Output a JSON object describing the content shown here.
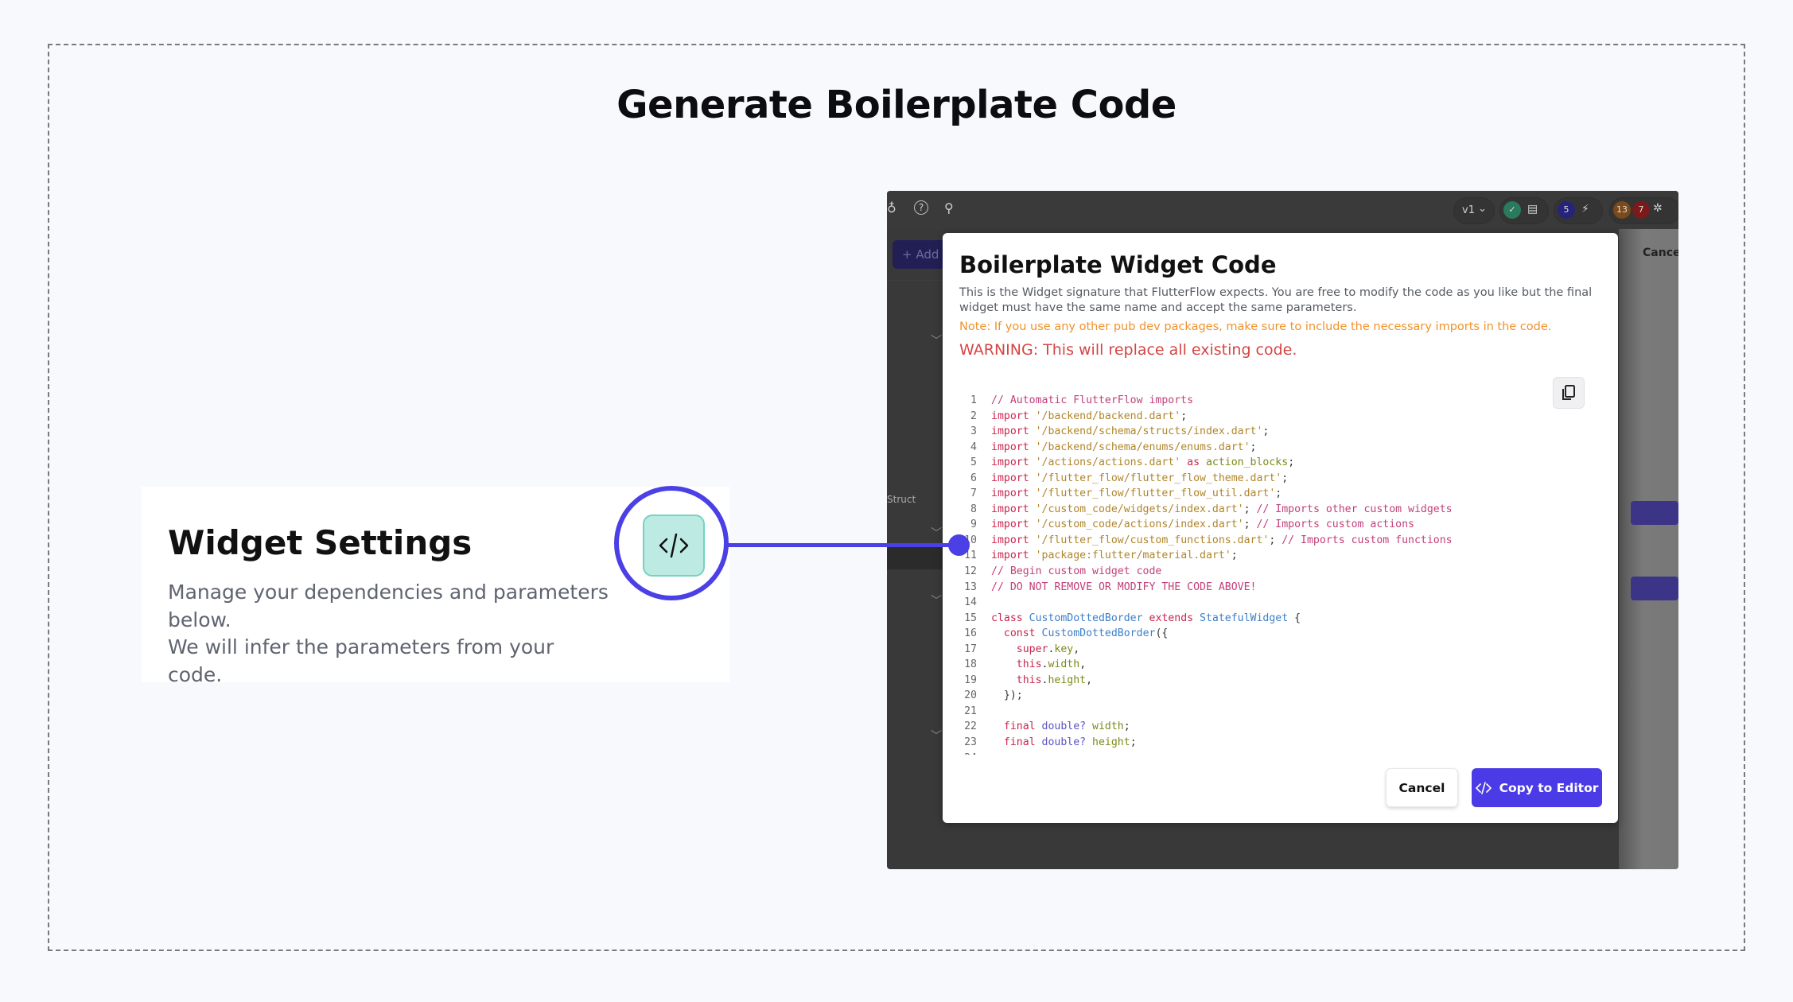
{
  "page": {
    "title": "Generate Boilerplate Code"
  },
  "widget_settings": {
    "title": "Widget Settings",
    "description_line1": "Manage your dependencies and parameters below.",
    "description_line2": "We will infer the parameters from your code.",
    "icon": "code-icon"
  },
  "colors": {
    "accent": "#4b3fe6",
    "teal": "#bdebe3",
    "note": "#f0922b",
    "warning": "#d64545",
    "app_bg": "#393939"
  },
  "app": {
    "topbar": {
      "version": "v1",
      "badge_blue": "5",
      "badge_orange": "13",
      "badge_red": "7"
    },
    "sidebar": {
      "add_label": "+ Add",
      "struct_label": "Struct"
    },
    "right_cancel": "Cance"
  },
  "modal": {
    "title": "Boilerplate Widget Code",
    "description": "This is the Widget signature that FlutterFlow expects. You are free to modify the code as you like but the final widget must have the same name and accept the same parameters.",
    "note": "Note: If you use any other pub dev packages, make sure to include the necessary imports in the code.",
    "warning": "WARNING: This will replace all existing code.",
    "cancel_label": "Cancel",
    "copy_label": "Copy to Editor",
    "code_lines": [
      [
        [
          "com",
          "// Automatic FlutterFlow imports"
        ]
      ],
      [
        [
          "kw",
          "import "
        ],
        [
          "str",
          "'/backend/backend.dart'"
        ],
        [
          "p",
          ";"
        ]
      ],
      [
        [
          "kw",
          "import "
        ],
        [
          "str",
          "'/backend/schema/structs/index.dart'"
        ],
        [
          "p",
          ";"
        ]
      ],
      [
        [
          "kw",
          "import "
        ],
        [
          "str",
          "'/backend/schema/enums/enums.dart'"
        ],
        [
          "p",
          ";"
        ]
      ],
      [
        [
          "kw",
          "import "
        ],
        [
          "str",
          "'/actions/actions.dart'"
        ],
        [
          "kw",
          " as "
        ],
        [
          "id",
          "action_blocks"
        ],
        [
          "p",
          ";"
        ]
      ],
      [
        [
          "kw",
          "import "
        ],
        [
          "str",
          "'/flutter_flow/flutter_flow_theme.dart'"
        ],
        [
          "p",
          ";"
        ]
      ],
      [
        [
          "kw",
          "import "
        ],
        [
          "str",
          "'/flutter_flow/flutter_flow_util.dart'"
        ],
        [
          "p",
          ";"
        ]
      ],
      [
        [
          "kw",
          "import "
        ],
        [
          "str",
          "'/custom_code/widgets/index.dart'"
        ],
        [
          "p",
          "; "
        ],
        [
          "com",
          "// Imports other custom widgets"
        ]
      ],
      [
        [
          "kw",
          "import "
        ],
        [
          "str",
          "'/custom_code/actions/index.dart'"
        ],
        [
          "p",
          "; "
        ],
        [
          "com",
          "// Imports custom actions"
        ]
      ],
      [
        [
          "kw",
          "import "
        ],
        [
          "str",
          "'/flutter_flow/custom_functions.dart'"
        ],
        [
          "p",
          "; "
        ],
        [
          "com",
          "// Imports custom functions"
        ]
      ],
      [
        [
          "kw",
          "import "
        ],
        [
          "str",
          "'package:flutter/material.dart'"
        ],
        [
          "p",
          ";"
        ]
      ],
      [
        [
          "com",
          "// Begin custom widget code"
        ]
      ],
      [
        [
          "com",
          "// DO NOT REMOVE OR MODIFY THE CODE ABOVE!"
        ]
      ],
      [],
      [
        [
          "kw",
          "class "
        ],
        [
          "cls",
          "CustomDottedBorder"
        ],
        [
          "kw",
          " extends "
        ],
        [
          "cls",
          "StatefulWidget"
        ],
        [
          "p",
          " {"
        ]
      ],
      [
        [
          "p",
          "  "
        ],
        [
          "kw",
          "const "
        ],
        [
          "cls",
          "CustomDottedBorder"
        ],
        [
          "p",
          "({"
        ]
      ],
      [
        [
          "p",
          "    "
        ],
        [
          "kw",
          "super"
        ],
        [
          "p",
          "."
        ],
        [
          "id",
          "key"
        ],
        [
          "p",
          ","
        ]
      ],
      [
        [
          "p",
          "    "
        ],
        [
          "kw",
          "this"
        ],
        [
          "p",
          "."
        ],
        [
          "id",
          "width"
        ],
        [
          "p",
          ","
        ]
      ],
      [
        [
          "p",
          "    "
        ],
        [
          "kw",
          "this"
        ],
        [
          "p",
          "."
        ],
        [
          "id",
          "height"
        ],
        [
          "p",
          ","
        ]
      ],
      [
        [
          "p",
          "  });"
        ]
      ],
      [],
      [
        [
          "p",
          "  "
        ],
        [
          "kw",
          "final "
        ],
        [
          "type",
          "double?"
        ],
        [
          "id",
          " width"
        ],
        [
          "p",
          ";"
        ]
      ],
      [
        [
          "p",
          "  "
        ],
        [
          "kw",
          "final "
        ],
        [
          "type",
          "double?"
        ],
        [
          "id",
          " height"
        ],
        [
          "p",
          ";"
        ]
      ],
      []
    ]
  }
}
